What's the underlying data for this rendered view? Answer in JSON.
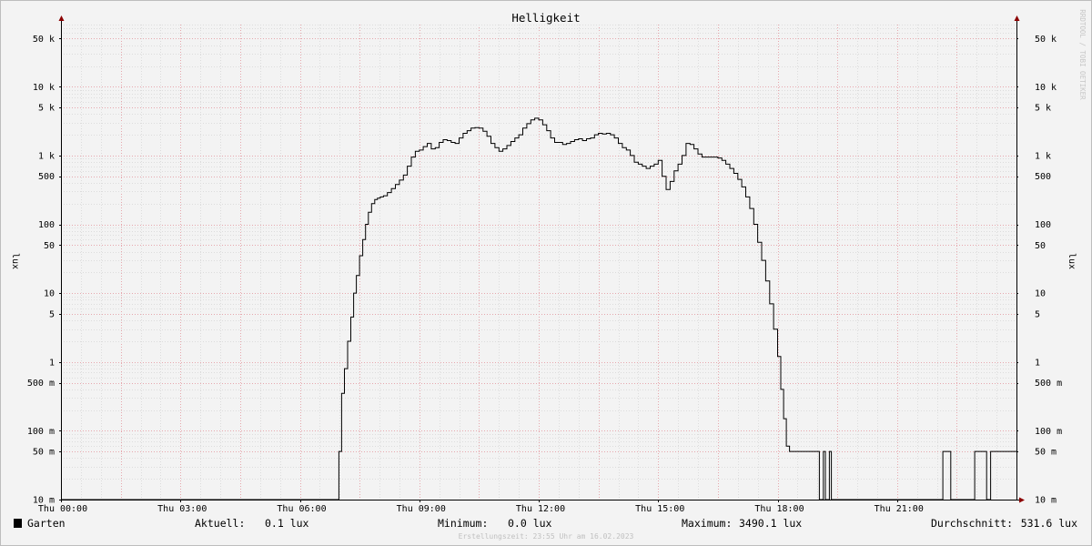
{
  "watermark": "RRDTOOL / TOBI OETIKER",
  "creation_note": "Erstellungszeit: 23:55 Uhr am 16.02.2023",
  "legend": {
    "series_name": "Garten",
    "series_color": "#000000",
    "current_label": "Aktuell:",
    "current_value": "0.1 lux",
    "min_label": "Minimum:",
    "min_value": "0.0 lux",
    "max_label": "Maximum:",
    "max_value": "3490.1 lux",
    "avg_label": "Durchschnitt:",
    "avg_value": "531.6 lux"
  },
  "chart_data": {
    "type": "line",
    "title": "Helligkeit",
    "ylabel": "lux",
    "yscale": "log",
    "ylim": [
      0.01,
      80000
    ],
    "xlim": [
      0,
      24
    ],
    "x_unit": "hours",
    "x_ticks": [
      {
        "x": 0,
        "label": "Thu 00:00"
      },
      {
        "x": 3,
        "label": "Thu 03:00"
      },
      {
        "x": 6,
        "label": "Thu 06:00"
      },
      {
        "x": 9,
        "label": "Thu 09:00"
      },
      {
        "x": 12,
        "label": "Thu 12:00"
      },
      {
        "x": 15,
        "label": "Thu 15:00"
      },
      {
        "x": 18,
        "label": "Thu 18:00"
      },
      {
        "x": 21,
        "label": "Thu 21:00"
      }
    ],
    "y_ticks": [
      {
        "y": 0.01,
        "label": "10 m"
      },
      {
        "y": 0.05,
        "label": "50 m"
      },
      {
        "y": 0.1,
        "label": "100 m"
      },
      {
        "y": 0.5,
        "label": "500 m"
      },
      {
        "y": 1,
        "label": "1"
      },
      {
        "y": 5,
        "label": "5"
      },
      {
        "y": 10,
        "label": "10"
      },
      {
        "y": 50,
        "label": "50"
      },
      {
        "y": 100,
        "label": "100"
      },
      {
        "y": 500,
        "label": "500"
      },
      {
        "y": 1000,
        "label": "1 k"
      },
      {
        "y": 5000,
        "label": "5 k"
      },
      {
        "y": 10000,
        "label": "10 k"
      },
      {
        "y": 50000,
        "label": "50 k"
      }
    ],
    "grid": true,
    "series": [
      {
        "name": "Garten",
        "color": "#000000",
        "x": [
          0,
          6.98,
          7.05,
          7.12,
          7.2,
          7.28,
          7.35,
          7.42,
          7.5,
          7.58,
          7.65,
          7.72,
          7.8,
          7.88,
          7.95,
          8.02,
          8.1,
          8.2,
          8.3,
          8.4,
          8.5,
          8.6,
          8.7,
          8.8,
          8.9,
          9.0,
          9.1,
          9.2,
          9.3,
          9.4,
          9.5,
          9.6,
          9.7,
          9.8,
          9.9,
          10.0,
          10.1,
          10.2,
          10.3,
          10.4,
          10.5,
          10.6,
          10.7,
          10.8,
          10.9,
          11.0,
          11.1,
          11.2,
          11.3,
          11.4,
          11.5,
          11.6,
          11.7,
          11.8,
          11.9,
          12.0,
          12.1,
          12.2,
          12.3,
          12.4,
          12.5,
          12.6,
          12.7,
          12.8,
          12.9,
          13.0,
          13.1,
          13.2,
          13.3,
          13.4,
          13.5,
          13.6,
          13.7,
          13.8,
          13.9,
          14.0,
          14.1,
          14.2,
          14.3,
          14.4,
          14.5,
          14.6,
          14.7,
          14.8,
          14.9,
          15.0,
          15.1,
          15.2,
          15.3,
          15.4,
          15.5,
          15.6,
          15.7,
          15.8,
          15.9,
          16.0,
          16.1,
          16.2,
          16.3,
          16.4,
          16.5,
          16.6,
          16.7,
          16.8,
          16.9,
          17.0,
          17.1,
          17.2,
          17.3,
          17.4,
          17.5,
          17.6,
          17.7,
          17.8,
          17.9,
          18.0,
          18.08,
          18.15,
          18.22,
          18.3,
          18.4,
          18.5,
          18.6,
          18.7,
          18.8,
          18.9,
          19.0,
          19.05,
          19.15,
          19.2,
          19.3,
          19.35,
          22.15,
          22.25,
          22.35,
          22.95,
          23.05,
          23.25,
          23.35,
          24
        ],
        "y": [
          0.01,
          0.05,
          0.35,
          0.8,
          2.0,
          4.5,
          10,
          18,
          35,
          60,
          100,
          150,
          200,
          230,
          240,
          250,
          260,
          290,
          330,
          380,
          440,
          520,
          700,
          950,
          1150,
          1200,
          1350,
          1500,
          1250,
          1300,
          1550,
          1700,
          1650,
          1550,
          1500,
          1800,
          2100,
          2300,
          2500,
          2550,
          2500,
          2250,
          1900,
          1500,
          1300,
          1150,
          1250,
          1400,
          1600,
          1800,
          2000,
          2500,
          2900,
          3300,
          3490,
          3300,
          2800,
          2300,
          1800,
          1550,
          1550,
          1450,
          1500,
          1600,
          1700,
          1750,
          1650,
          1750,
          1800,
          2000,
          2100,
          2050,
          2100,
          2000,
          1800,
          1500,
          1300,
          1200,
          1000,
          800,
          750,
          700,
          650,
          700,
          750,
          850,
          500,
          320,
          420,
          600,
          750,
          1000,
          1500,
          1450,
          1250,
          1050,
          950,
          950,
          950,
          950,
          920,
          850,
          750,
          650,
          550,
          450,
          350,
          250,
          170,
          100,
          55,
          30,
          15,
          7,
          3,
          1.2,
          0.4,
          0.15,
          0.06,
          0.05,
          0.05,
          0.05,
          0.05,
          0.05,
          0.05,
          0.05,
          0.05,
          0.005,
          0.05,
          0.005,
          0.05,
          0.005,
          0.05,
          0.05,
          0.005,
          0.05,
          0.05,
          0.005,
          0.05,
          0.05
        ]
      }
    ]
  }
}
